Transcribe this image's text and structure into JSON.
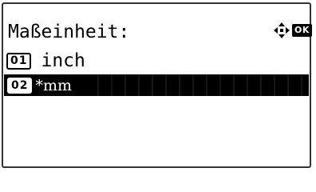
{
  "screen": {
    "title": "Maßeinheit:",
    "icons": {
      "nav": "four-way-arrow-icon",
      "ok": "OK"
    }
  },
  "menu": {
    "items": [
      {
        "number": "01",
        "label": "inch",
        "selected": false
      },
      {
        "number": "02",
        "label": "*mm",
        "selected": true
      }
    ]
  },
  "colors": {
    "background": "#ffffff",
    "text": "#000000",
    "highlight": "#000000",
    "highlight_text": "#ffffff"
  }
}
